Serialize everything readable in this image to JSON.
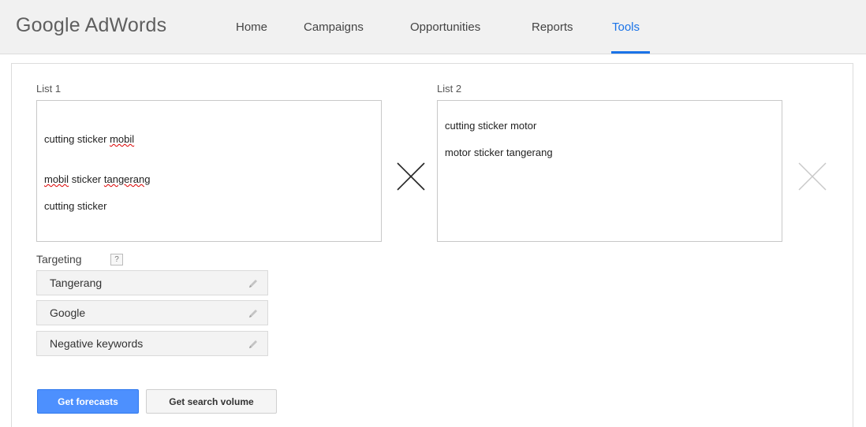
{
  "header": {
    "brand": "Google AdWords",
    "nav": [
      {
        "label": "Home"
      },
      {
        "label": "Campaigns"
      },
      {
        "label": "Opportunities"
      },
      {
        "label": "Reports"
      },
      {
        "label": "Tools"
      }
    ],
    "active_nav": "Tools"
  },
  "list1": {
    "label": "List 1",
    "lines": [
      "cutting sticker mobil",
      "mobil sticker tangerang",
      "cutting sticker"
    ]
  },
  "list2": {
    "label": "List 2",
    "lines": [
      "cutting sticker motor",
      "motor sticker tangerang"
    ]
  },
  "targeting": {
    "label": "Targeting",
    "help": "?",
    "items": [
      {
        "label": "Tangerang"
      },
      {
        "label": "Google"
      },
      {
        "label": "Negative keywords"
      }
    ]
  },
  "actions": {
    "primary_label": "Get forecasts",
    "secondary_label": "Get search volume"
  },
  "colors": {
    "accent": "#4d90fe",
    "active_nav": "#1a73e8"
  }
}
